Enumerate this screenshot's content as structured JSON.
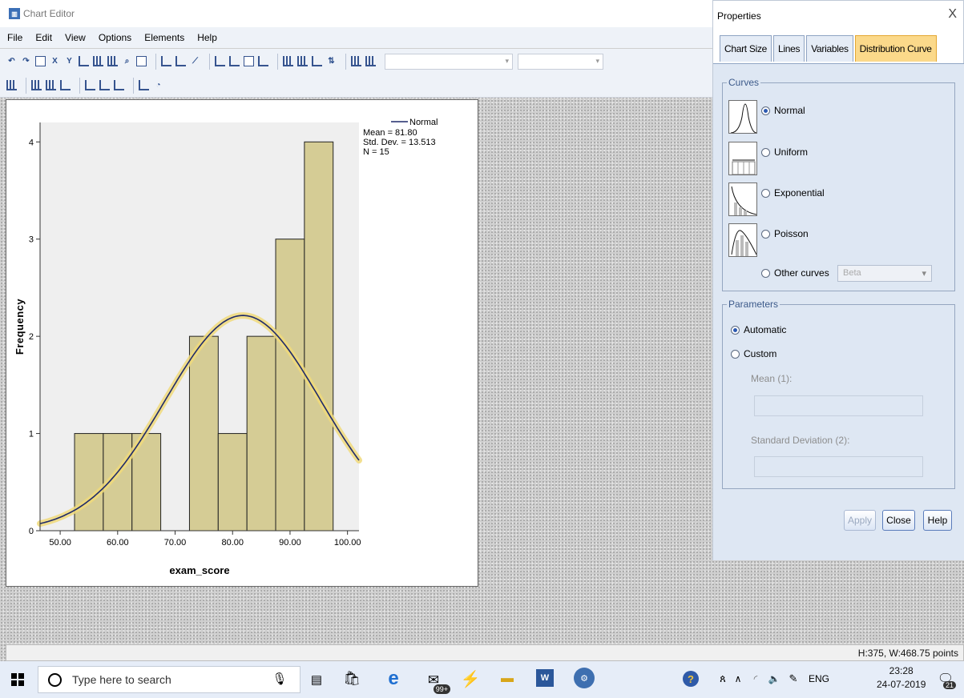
{
  "window": {
    "title": "Chart Editor"
  },
  "menu": [
    "File",
    "Edit",
    "View",
    "Options",
    "Elements",
    "Help"
  ],
  "chart_data": {
    "type": "bar",
    "title": "",
    "xlabel": "exam_score",
    "ylabel": "Frequency",
    "x_ticks": [
      "50.00",
      "60.00",
      "70.00",
      "80.00",
      "90.00",
      "100.00"
    ],
    "y_ticks": [
      "0",
      "1",
      "2",
      "3",
      "4"
    ],
    "xlim": [
      46.5,
      102
    ],
    "ylim": [
      0,
      4.2
    ],
    "bins": [
      {
        "start": 52.5,
        "end": 57.5,
        "value": 1
      },
      {
        "start": 57.5,
        "end": 62.5,
        "value": 1
      },
      {
        "start": 62.5,
        "end": 67.5,
        "value": 1
      },
      {
        "start": 67.5,
        "end": 72.5,
        "value": 0
      },
      {
        "start": 72.5,
        "end": 77.5,
        "value": 2
      },
      {
        "start": 77.5,
        "end": 82.5,
        "value": 1
      },
      {
        "start": 82.5,
        "end": 87.5,
        "value": 2
      },
      {
        "start": 87.5,
        "end": 92.5,
        "value": 3
      },
      {
        "start": 92.5,
        "end": 97.5,
        "value": 4
      }
    ],
    "curve": {
      "type": "normal",
      "mean": 81.8,
      "sd": 13.513,
      "n": 15,
      "bin_width": 5
    },
    "legend": {
      "series_label": "Normal",
      "lines": [
        "Mean = 81.80",
        "Std. Dev. = 13.513",
        "N = 15"
      ],
      "position": "top-right"
    },
    "bar_color": "#d5cc95",
    "curve_color": "#1f2a6a",
    "curve_highlight": "#f0d97a",
    "grid": false
  },
  "properties": {
    "title": "Properties",
    "close": "X",
    "tabs": [
      "Chart Size",
      "Lines",
      "Variables",
      "Distribution Curve"
    ],
    "active_tab": "Distribution Curve",
    "curves_legend": "Curves",
    "curves": [
      "Normal",
      "Uniform",
      "Exponential",
      "Poisson"
    ],
    "other_curves": "Other curves",
    "other_value": "Beta",
    "selected_curve": "Normal",
    "params_legend": "Parameters",
    "automatic": "Automatic",
    "custom": "Custom",
    "mean_label": "Mean (1):",
    "sd_label": "Standard Deviation (2):",
    "apply": "Apply",
    "close_btn": "Close",
    "help": "Help"
  },
  "status": {
    "text": "H:375, W:468.75 points"
  },
  "taskbar": {
    "search_placeholder": "Type here to search",
    "time": "23:28",
    "date": "24-07-2019",
    "lang": "ENG",
    "notifications": "21",
    "mail_badge": "99+"
  }
}
